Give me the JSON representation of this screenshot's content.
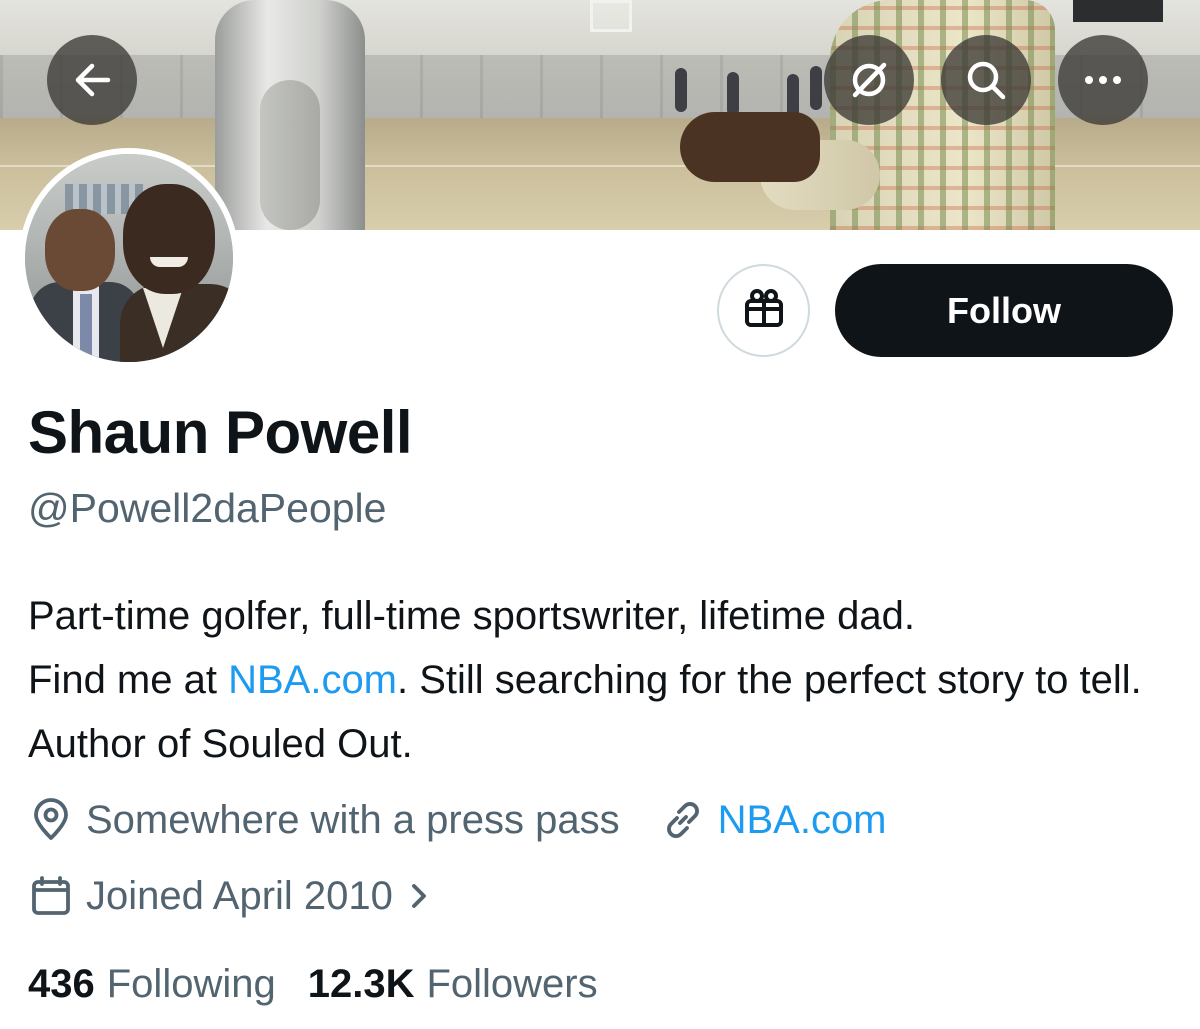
{
  "profile": {
    "display_name": "Shaun Powell",
    "handle": "@Powell2daPeople",
    "bio": {
      "part1": "Part-time golfer, full-time sportswriter, lifetime dad.",
      "part2": "Find me at ",
      "link": "NBA.com",
      "part3": ". Still searching for the perfect story to tell. Author of Souled Out."
    },
    "location": "Somewhere with a press pass",
    "website": "NBA.com",
    "joined": "Joined April 2010",
    "following_count": "436",
    "following_label": "Following",
    "followers_count": "12.3K",
    "followers_label": "Followers"
  },
  "actions": {
    "follow_label": "Follow"
  },
  "icons": {
    "back": "arrow-left-icon",
    "grok": "grok-icon",
    "search": "search-icon",
    "more": "more-icon",
    "gift": "gift-icon",
    "location": "location-pin-icon",
    "link": "link-icon",
    "calendar": "calendar-icon",
    "chevron": "chevron-right-icon"
  },
  "colors": {
    "text_primary": "#0f1419",
    "text_secondary": "#536471",
    "link": "#1d9bf0",
    "follow_bg": "#0f1419"
  }
}
